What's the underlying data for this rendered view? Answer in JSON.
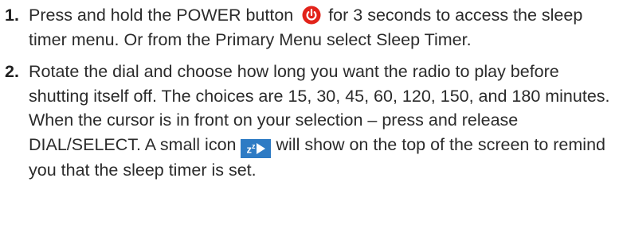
{
  "steps": [
    {
      "number": "1.",
      "text_before_icon": "Press and hold the POWER button",
      "icon": "power-icon",
      "text_after_icon": "for 3 seconds to access the sleep timer menu. Or from the Primary Menu select Sleep Timer."
    },
    {
      "number": "2.",
      "text_before_icon": "Rotate the dial and choose how long you want the radio to play before shutting itself off. The choices are 15, 30, 45, 60, 120, 150, and 180 minutes. When the cursor is in front on your selection – press and release DIAL/SELECT. A small icon",
      "icon": "sleep-timer-icon",
      "text_after_icon": "will show on the top of the screen to remind you that the sleep timer is set."
    }
  ],
  "colors": {
    "text": "#2b2b2b",
    "power_icon": "#e2231a",
    "sleep_icon_bg": "#2e7bc4"
  }
}
